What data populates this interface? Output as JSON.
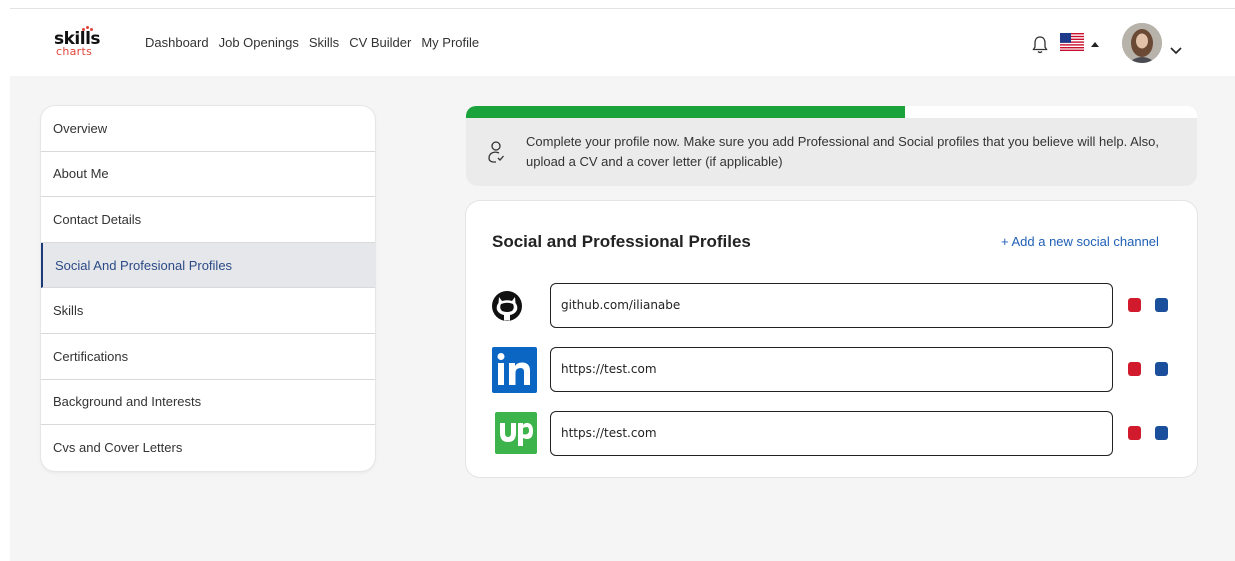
{
  "logo": {
    "line1": "skills",
    "line2": "charts"
  },
  "nav": [
    "Dashboard",
    "Job Openings",
    "Skills",
    "CV Builder",
    "My Profile"
  ],
  "icons": {
    "bell": "bell-icon",
    "flag": "us-flag-icon",
    "profile_menu": "chevron-down-icon"
  },
  "sidebar": {
    "items": [
      {
        "label": "Overview"
      },
      {
        "label": "About Me"
      },
      {
        "label": "Contact Details"
      },
      {
        "label": "Social And Profesional Profiles",
        "active": true
      },
      {
        "label": "Skills"
      },
      {
        "label": "Certifications"
      },
      {
        "label": "Background and Interests"
      },
      {
        "label": "Cvs and Cover Letters"
      }
    ]
  },
  "progress": {
    "fraction": 0.6
  },
  "notice": {
    "text": "Complete your profile now. Make sure you add Professional and Social profiles that you believe will help. Also, upload a CV and a cover letter (if applicable)"
  },
  "card": {
    "title": "Social and Professional Profiles",
    "add_label": "+ Add a new social channel",
    "profiles": [
      {
        "network": "github",
        "value": "github.com/ilianabe"
      },
      {
        "network": "linkedin",
        "value": "https://test.com"
      },
      {
        "network": "upwork",
        "value": "https://test.com"
      }
    ]
  },
  "colors": {
    "accent": "#1f5fb5",
    "progress": "#1aa33a",
    "delete": "#d11b2d",
    "edit": "#1b4e9b"
  }
}
